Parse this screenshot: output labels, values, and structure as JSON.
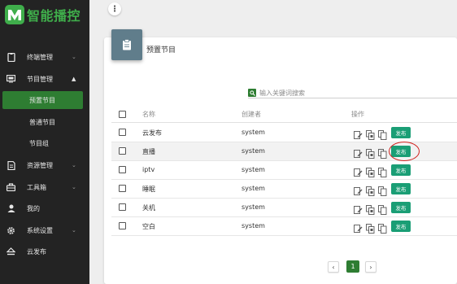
{
  "brand": {
    "name": "智能播控",
    "logo_color": "#3fae4b"
  },
  "sidebar": {
    "items": [
      {
        "label": "终端管理",
        "icon": "tablet-icon",
        "arrow": "⌄"
      },
      {
        "label": "节目管理",
        "icon": "monitor-icon",
        "arrow": "⌃"
      },
      {
        "label": "预置节目",
        "sub": true,
        "active": true
      },
      {
        "label": "普通节目",
        "sub": true
      },
      {
        "label": "节目组",
        "sub": true
      },
      {
        "label": "资源管理",
        "icon": "document-icon",
        "arrow": "⌄"
      },
      {
        "label": "工具箱",
        "icon": "toolbox-icon",
        "arrow": "⌄"
      },
      {
        "label": "我的",
        "icon": "person-icon"
      },
      {
        "label": "系统设置",
        "icon": "gear-icon",
        "arrow": "⌄"
      },
      {
        "label": "云发布",
        "icon": "eject-icon"
      }
    ]
  },
  "page": {
    "title": "预置节目"
  },
  "search": {
    "placeholder": "输入关键词搜索"
  },
  "table": {
    "headers": {
      "name": "名称",
      "creator": "创建者",
      "actions": "操作"
    },
    "rows": [
      {
        "name": "云发布",
        "creator": "system",
        "publish": "发布"
      },
      {
        "name": "直播",
        "creator": "system",
        "publish": "发布"
      },
      {
        "name": "iptv",
        "creator": "system",
        "publish": "发布"
      },
      {
        "name": "睡眠",
        "creator": "system",
        "publish": "发布"
      },
      {
        "name": "关机",
        "creator": "system",
        "publish": "发布"
      },
      {
        "name": "空白",
        "creator": "system",
        "publish": "发布"
      }
    ]
  },
  "pagination": {
    "prev": "‹",
    "current": "1",
    "next": "›"
  },
  "colors": {
    "sidebar_bg": "#232323",
    "active_green": "#2e7d32",
    "publish_btn": "#1a9e75",
    "highlight_circle": "#d0221e",
    "card_icon_bg": "#607d8b"
  }
}
